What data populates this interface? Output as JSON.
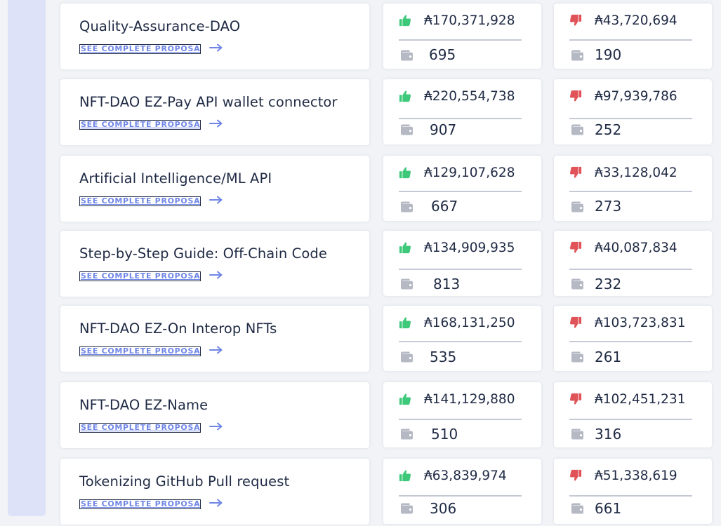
{
  "colors": {
    "yes": "#3ec97a",
    "no": "#e05459",
    "link": "#6f86e6",
    "wallet": "#b5b9c4",
    "text": "#1f2a44",
    "rail": "#dde2f9"
  },
  "icons": {
    "yes": "thumbs-up-icon",
    "no": "thumbs-down-icon",
    "wallet": "wallet-icon",
    "arrow": "arrow-right-icon"
  },
  "link_label": "SEE COMPLETE PROPOSAL",
  "proposals": [
    {
      "title": "Quality-Assurance-DAO",
      "yes_amount": "₳170,371,928",
      "yes_count": "695",
      "no_amount": "₳43,720,694",
      "no_count": "190"
    },
    {
      "title": "NFT-DAO EZ-Pay API wallet connector",
      "yes_amount": "₳220,554,738",
      "yes_count": "907",
      "no_amount": "₳97,939,786",
      "no_count": "252"
    },
    {
      "title": "Artificial Intelligence/ML API",
      "yes_amount": "₳129,107,628",
      "yes_count": "667",
      "no_amount": "₳33,128,042",
      "no_count": "273"
    },
    {
      "title": "Step-by-Step Guide: Off-Chain Code",
      "yes_amount": "₳134,909,935",
      "yes_count": "813",
      "no_amount": "₳40,087,834",
      "no_count": "232"
    },
    {
      "title": "NFT-DAO EZ-On Interop NFTs",
      "yes_amount": "₳168,131,250",
      "yes_count": "535",
      "no_amount": "₳103,723,831",
      "no_count": "261"
    },
    {
      "title": "NFT-DAO EZ-Name",
      "yes_amount": "₳141,129,880",
      "yes_count": "510",
      "no_amount": "₳102,451,231",
      "no_count": "316"
    },
    {
      "title": "Tokenizing GitHub Pull request",
      "yes_amount": "₳63,839,974",
      "yes_count": "306",
      "no_amount": "₳51,338,619",
      "no_count": "661"
    }
  ]
}
